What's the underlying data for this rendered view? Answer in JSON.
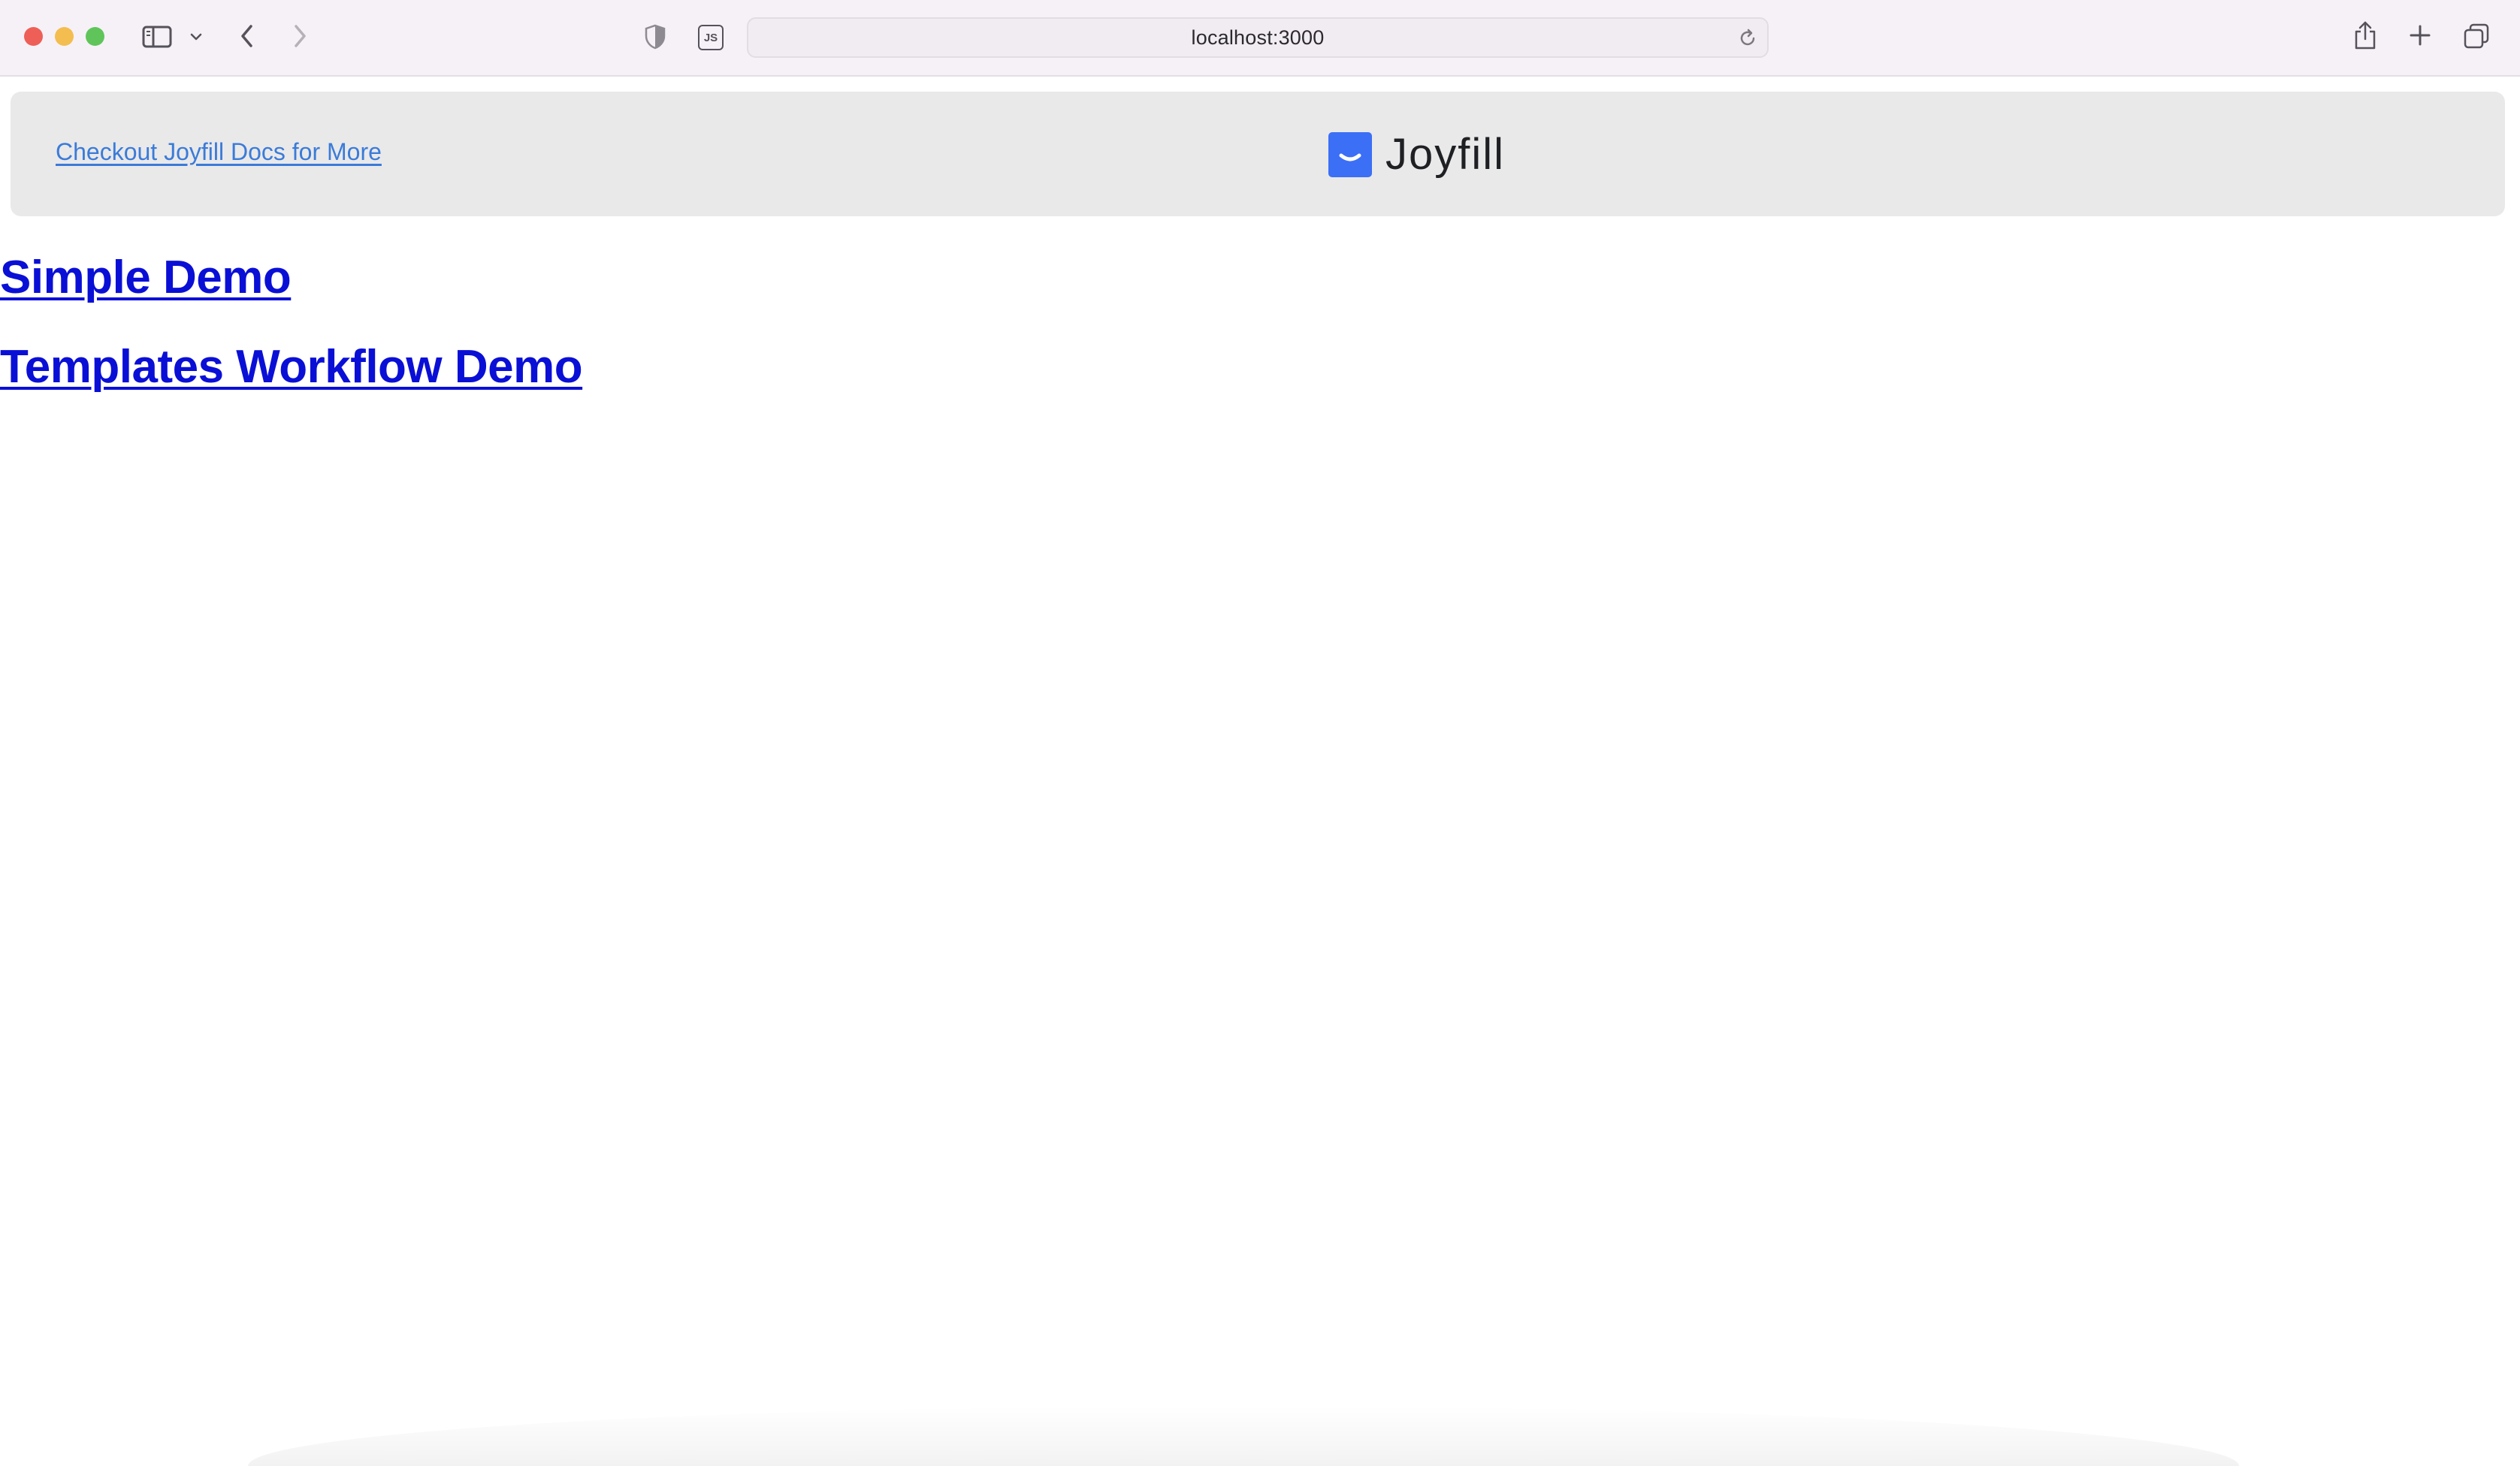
{
  "browser": {
    "url": "localhost:3000",
    "colors": {
      "toolbar_bg": "#f6f1f7",
      "close": "#ee5f57",
      "minimize": "#f4bd4f",
      "maximize": "#5fc55a"
    },
    "icons": {
      "sidebar": "sidebar-toggle-icon",
      "dropdown": "chevron-down-icon",
      "back": "chevron-left-icon",
      "forward": "chevron-right-icon",
      "privacy": "shield-icon",
      "extension": "js-extension-icon",
      "reload": "reload-icon",
      "share": "share-icon",
      "new_tab": "plus-icon",
      "tabs": "tab-overview-icon"
    },
    "extension_label": "JS"
  },
  "header": {
    "docs_link": "Checkout Joyfill Docs for More",
    "brand_name": "Joyfill",
    "colors": {
      "background": "#e9e9ea",
      "link": "#3b7bd8",
      "logo": "#3b6ff6"
    }
  },
  "links": [
    {
      "label": "Simple Demo"
    },
    {
      "label": "Templates Workflow Demo"
    }
  ],
  "colors": {
    "demo_link": "#0a0fd6"
  }
}
